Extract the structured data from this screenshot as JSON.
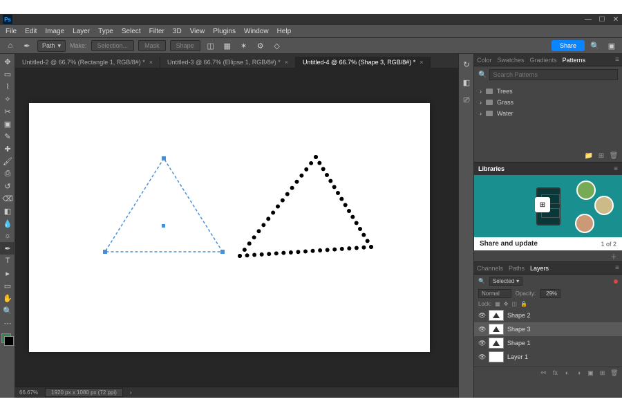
{
  "menubar": [
    "File",
    "Edit",
    "Image",
    "Layer",
    "Type",
    "Select",
    "Filter",
    "3D",
    "View",
    "Plugins",
    "Window",
    "Help"
  ],
  "optionsbar": {
    "mode": "Path",
    "make_label": "Make:",
    "buttons": [
      "Selection...",
      "Mask",
      "Shape"
    ],
    "share": "Share"
  },
  "tabs": [
    {
      "title": "Untitled-2 @ 66.7% (Rectangle 1, RGB/8#) *"
    },
    {
      "title": "Untitled-3 @ 66.7% (Ellipse 1, RGB/8#) *"
    },
    {
      "title": "Untitled-4 @ 66.7% (Shape 3, RGB/8#) *"
    }
  ],
  "active_tab": 2,
  "status": {
    "zoom": "66.67%",
    "docinfo": "1920 px x 1080 px (72 ppi)"
  },
  "patterns_panel": {
    "tabs": [
      "Color",
      "Swatches",
      "Gradients",
      "Patterns"
    ],
    "active": 3,
    "search_placeholder": "Search Patterns",
    "folders": [
      "Trees",
      "Grass",
      "Water"
    ]
  },
  "libraries": {
    "tab": "Libraries",
    "caption": "Share and update",
    "page": "1 of 2"
  },
  "layers_panel": {
    "tabs": [
      "Channels",
      "Paths",
      "Layers"
    ],
    "active": 2,
    "filter": "Selected",
    "blend": "Normal",
    "opacity_label": "Opacity:",
    "opacity": "29%",
    "lock_label": "Lock:",
    "layers": [
      {
        "name": "Shape 2",
        "sel": false
      },
      {
        "name": "Shape 3",
        "sel": true
      },
      {
        "name": "Shape 1",
        "sel": false
      },
      {
        "name": "Layer 1",
        "sel": false
      }
    ]
  }
}
